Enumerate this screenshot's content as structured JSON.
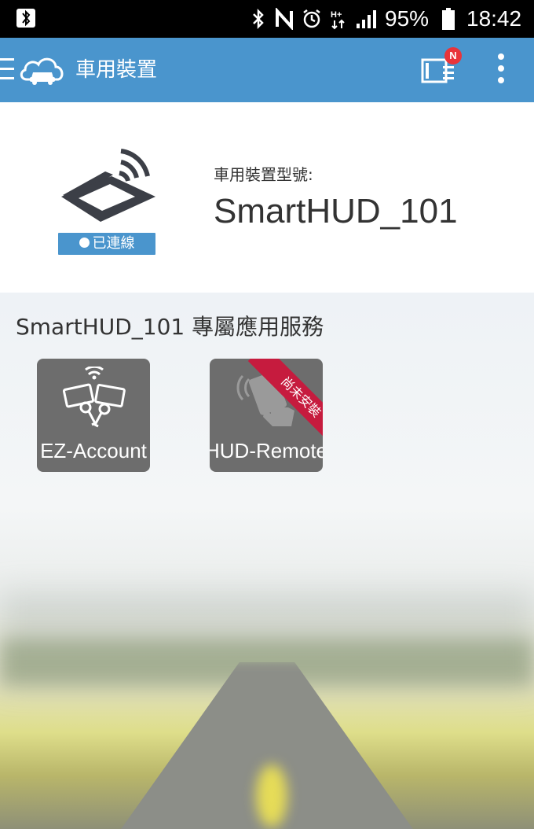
{
  "status_bar": {
    "battery_text": "95%",
    "time": "18:42",
    "icons": [
      "bluetooth-icon",
      "nfc-icon",
      "alarm-icon",
      "data-arrows-icon",
      "signal-icon",
      "battery-icon"
    ]
  },
  "app_bar": {
    "title": "車用裝置",
    "news_badge": "N",
    "accent_color": "#4a95cd"
  },
  "device": {
    "model_label": "車用裝置型號:",
    "model_name": "SmartHUD_101",
    "status": "已連線"
  },
  "services": {
    "title": "SmartHUD_101 專屬應用服務",
    "apps": [
      {
        "label": "EZ-Account",
        "installed": true
      },
      {
        "label": "HUD-Remote",
        "installed": false,
        "ribbon": "尚未安裝"
      }
    ],
    "ribbon_color": "#c61b3e"
  }
}
